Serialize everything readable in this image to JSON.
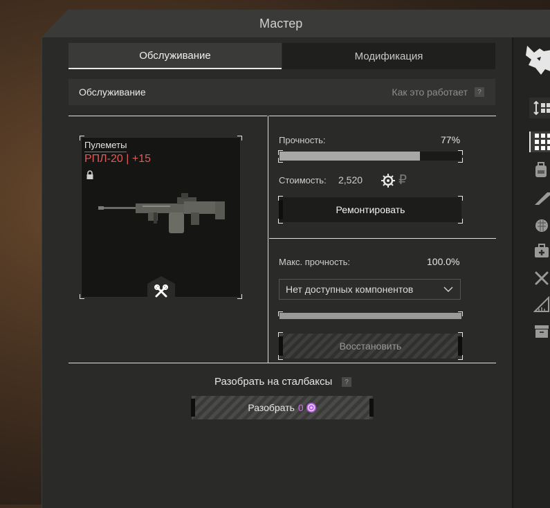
{
  "window": {
    "title": "Мастер"
  },
  "tabs": [
    {
      "label": "Обслуживание",
      "active": true
    },
    {
      "label": "Модификация",
      "active": false
    }
  ],
  "section": {
    "title": "Обслуживание",
    "how_it_works": "Как это работает",
    "help_mark": "?"
  },
  "item": {
    "category": "Пулеметы",
    "name": "РПЛ-20 | +15",
    "name_color": "#e25a5a",
    "icon": "machine-gun-image"
  },
  "repair": {
    "durability_label": "Прочность:",
    "durability_value": "77%",
    "durability_fraction": 0.77,
    "cost_label": "Стоимость:",
    "cost_value": "2,520",
    "cost_icons": [
      "gear-coin-icon",
      "ruble-icon"
    ],
    "ruble_symbol": "₽",
    "repair_button": "Ремонтировать"
  },
  "restore": {
    "max_durability_label": "Макс. прочность:",
    "max_durability_value": "100.0%",
    "max_durability_fraction": 1.0,
    "components_select": "Нет доступных компонентов",
    "restore_button": "Восстановить"
  },
  "disassemble": {
    "title": "Разобрать на сталбаксы",
    "help_mark": "?",
    "button_label": "Разобрать",
    "amount": "0",
    "amount_color": "#c96ee8",
    "currency_icon": "stalbucks-icon"
  },
  "sidebar": {
    "icons": [
      "wolf-logo-icon",
      "sort-icon",
      "grid-all-icon",
      "backpack-icon",
      "rifle-icon",
      "grenade-icon",
      "medkit-icon",
      "tools-icon",
      "blueprint-icon",
      "archive-icon"
    ]
  }
}
